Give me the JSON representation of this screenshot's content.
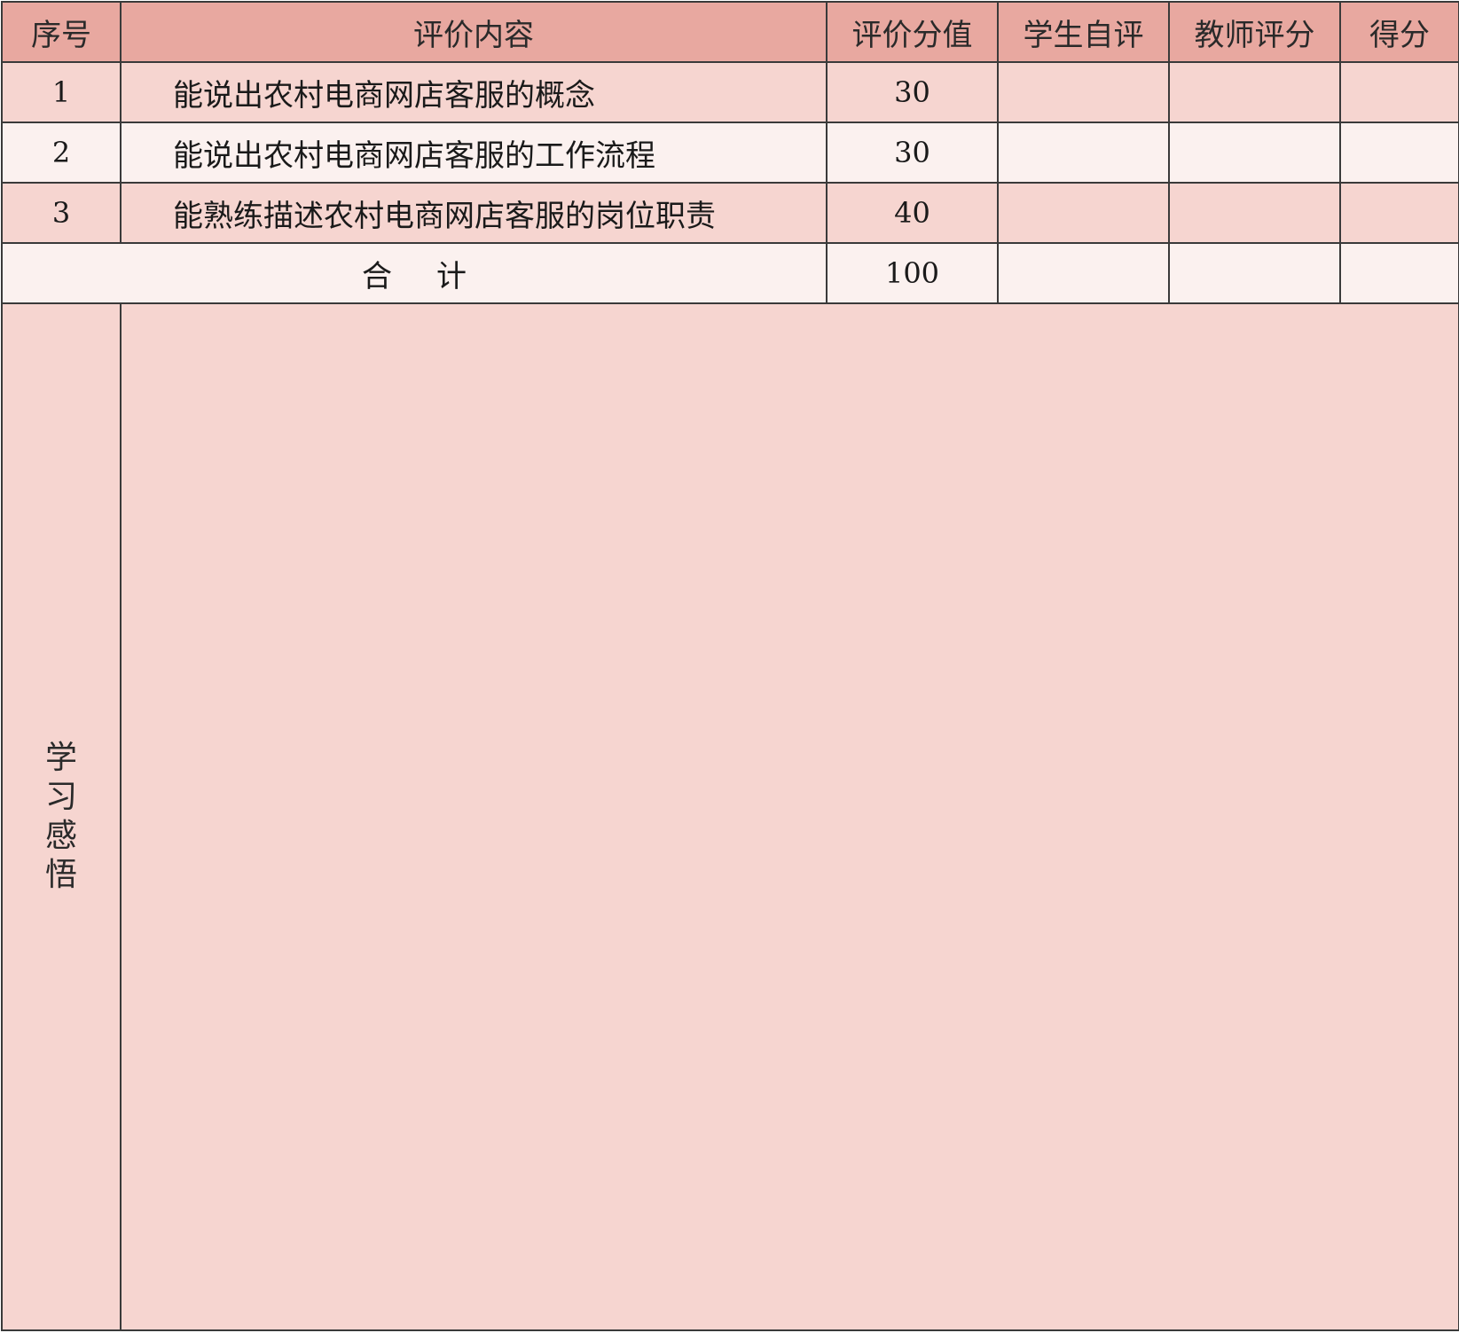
{
  "table": {
    "headers": [
      "序号",
      "评价内容",
      "评价分值",
      "学生自评",
      "教师评分",
      "得分"
    ],
    "rows": [
      {
        "index": "1",
        "content": "能说出农村电商网店客服的概念",
        "score": "30",
        "self": "",
        "teacher": "",
        "final": ""
      },
      {
        "index": "2",
        "content": "能说出农村电商网店客服的工作流程",
        "score": "30",
        "self": "",
        "teacher": "",
        "final": ""
      },
      {
        "index": "3",
        "content": "能熟练描述农村电商网店客服的岗位职责",
        "score": "40",
        "self": "",
        "teacher": "",
        "final": ""
      }
    ],
    "total": {
      "label_left": "合",
      "label_right": "计",
      "score": "100",
      "self": "",
      "teacher": "",
      "final": ""
    },
    "reflection": {
      "label": "学习感悟",
      "content": ""
    }
  },
  "colors": {
    "header_bg": "#e8a8a0",
    "row_pink": "#f6d5d0",
    "row_light": "#fbf1ef",
    "border": "#3a3a3a"
  }
}
